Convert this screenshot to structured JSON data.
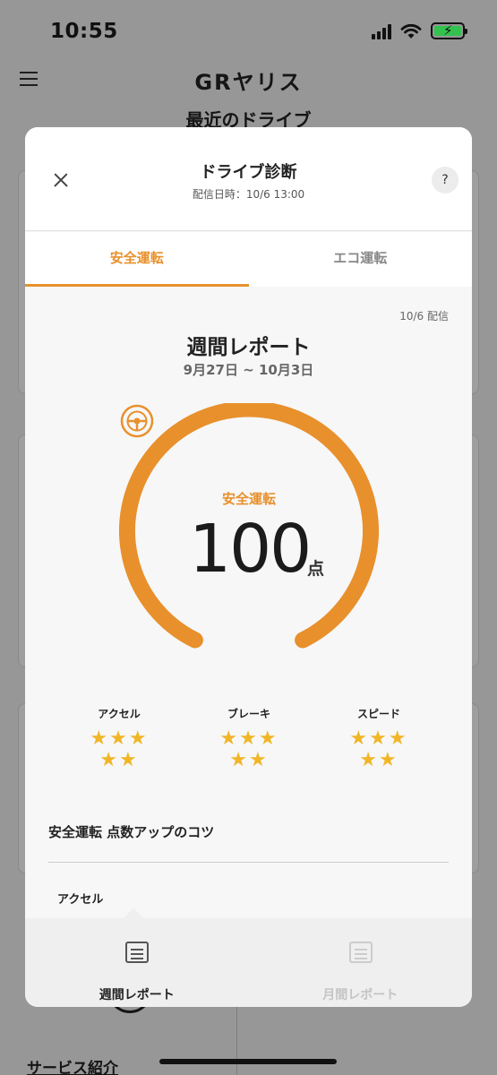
{
  "status": {
    "time": "10:55"
  },
  "app": {
    "title": "GRヤリス",
    "section_title": "最近のドライブ",
    "service_link": "サービス紹介"
  },
  "modal": {
    "title": "ドライブ診断",
    "subtitle": "配信日時：10/6 13:00",
    "help": "?",
    "tabs": [
      {
        "label": "安全運転",
        "active": true
      },
      {
        "label": "エコ運転",
        "active": false
      }
    ],
    "delivered": "10/6 配信",
    "report_title": "週間レポート",
    "report_range": "9月27日 ~ 10月3日",
    "gauge": {
      "label": "安全運転",
      "score": "100",
      "unit": "点",
      "accent": "#e8902c"
    },
    "ratings": [
      {
        "label": "アクセル",
        "stars": 5
      },
      {
        "label": "ブレーキ",
        "stars": 5
      },
      {
        "label": "スピード",
        "stars": 5
      }
    ],
    "tips_title": "安全運転 点数アップのコツ",
    "tips_item": "アクセル",
    "bottom_nav": [
      {
        "label": "週間レポート",
        "active": true,
        "icon": "weekly-report-icon"
      },
      {
        "label": "月間レポート",
        "active": false,
        "icon": "monthly-report-icon"
      }
    ]
  }
}
